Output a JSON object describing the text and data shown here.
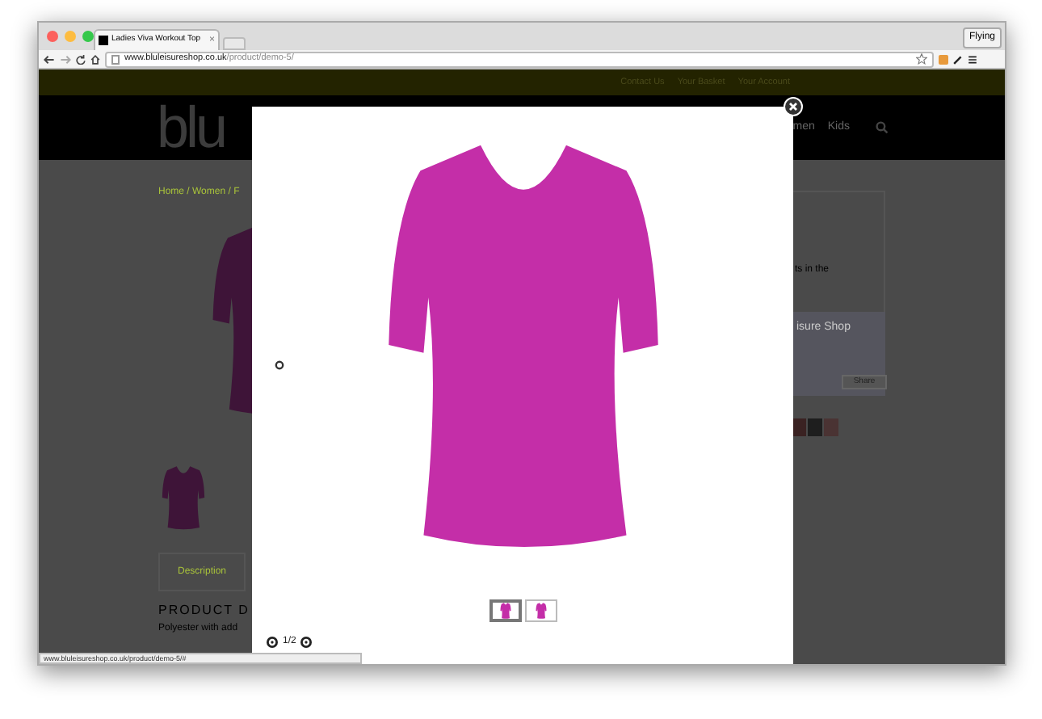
{
  "browser": {
    "tab": {
      "title": "Ladies Viva Workout Top",
      "close": "×"
    },
    "profile": "Flying",
    "url": {
      "host": "www.bluleisureshop.co.uk",
      "path": "/product/demo-5/"
    }
  },
  "top_bar": {
    "links": [
      "Contact Us",
      "Your Basket",
      "Your Account"
    ]
  },
  "header": {
    "logo": "blu",
    "nav": [
      "men",
      "Kids"
    ]
  },
  "breadcrumb": "Home / Women / F",
  "description_tab": "Description",
  "product_heading": "PRODUCT D",
  "product_text": "Polyester with add",
  "sidebar": {
    "snippet": "ts in the",
    "widget_title": "isure Shop",
    "share": "Share"
  },
  "lightbox": {
    "counter": "1/2",
    "thumbnails": [
      {
        "selected": true
      },
      {
        "selected": false
      }
    ]
  },
  "status_bar": "www.bluleisureshop.co.uk/product/demo-5/#"
}
